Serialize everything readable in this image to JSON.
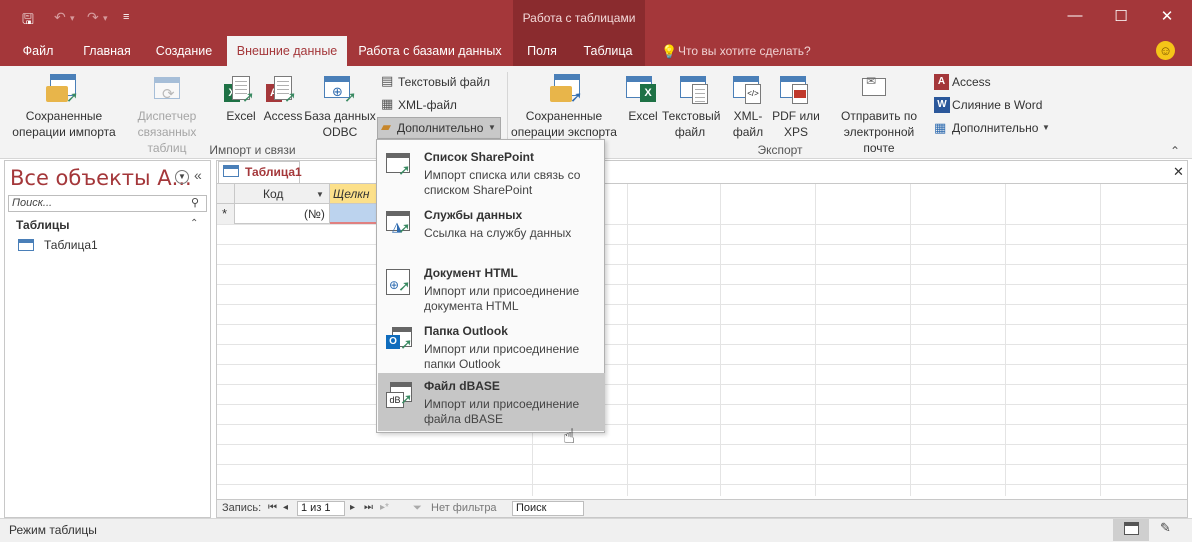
{
  "titlebar": {
    "context_title": "Работа с таблицами",
    "window_buttons": [
      "—",
      "☐",
      "✕"
    ]
  },
  "tabs": [
    {
      "label": "Файл"
    },
    {
      "label": "Главная"
    },
    {
      "label": "Создание"
    },
    {
      "label": "Внешние данные"
    },
    {
      "label": "Работа с базами данных"
    },
    {
      "label": "Поля"
    },
    {
      "label": "Таблица"
    }
  ],
  "tell_me": "Что вы хотите сделать?",
  "ribbon": {
    "import_group": {
      "label": "Импорт и связи",
      "saved_imports": "Сохраненные операции импорта",
      "linked_table_manager": "Диспетчер связанных таблиц",
      "excel": "Excel",
      "access": "Access",
      "odbc": "База данных ODBC",
      "text_file": "Текстовый файл",
      "xml_file": "XML-файл",
      "more": "Дополнительно"
    },
    "export_group": {
      "label": "Экспорт",
      "saved_exports": "Сохраненные операции экспорта",
      "excel": "Excel",
      "text_file": "Текстовый файл",
      "xml_file": "XML-файл",
      "pdf_xps": "PDF или XPS",
      "email": "Отправить по электронной почте",
      "access": "Access",
      "word_merge": "Слияние в Word",
      "more": "Дополнительно"
    }
  },
  "nav_pane": {
    "title": "Все объекты А...",
    "search_placeholder": "Поиск...",
    "section": "Таблицы",
    "items": [
      "Таблица1"
    ]
  },
  "document": {
    "tab_label": "Таблица1",
    "columns": [
      "Код",
      "Щелкн"
    ],
    "new_row_marker": "*",
    "new_row_value": "(№)"
  },
  "record_nav": {
    "label": "Запись:",
    "position": "1 из 1",
    "filter": "Нет фильтра",
    "search": "Поиск"
  },
  "statusbar": {
    "text": "Режим таблицы"
  },
  "menu": {
    "items": [
      {
        "title": "Список SharePoint",
        "desc": "Импорт списка или связь со списком SharePoint"
      },
      {
        "title": "Службы данных",
        "desc": "Ссылка на службу данных"
      },
      {
        "title": "Документ HTML",
        "desc": "Импорт или присоединение документа HTML"
      },
      {
        "title": "Папка Outlook",
        "desc": "Импорт или присоединение папки Outlook"
      },
      {
        "title": "Файл dBASE",
        "desc": "Импорт или присоединение файла dBASE"
      }
    ]
  },
  "colors": {
    "brand": "#a4373a",
    "context": "#8a2b2e",
    "ribbon_bg": "#f3f3f3"
  }
}
